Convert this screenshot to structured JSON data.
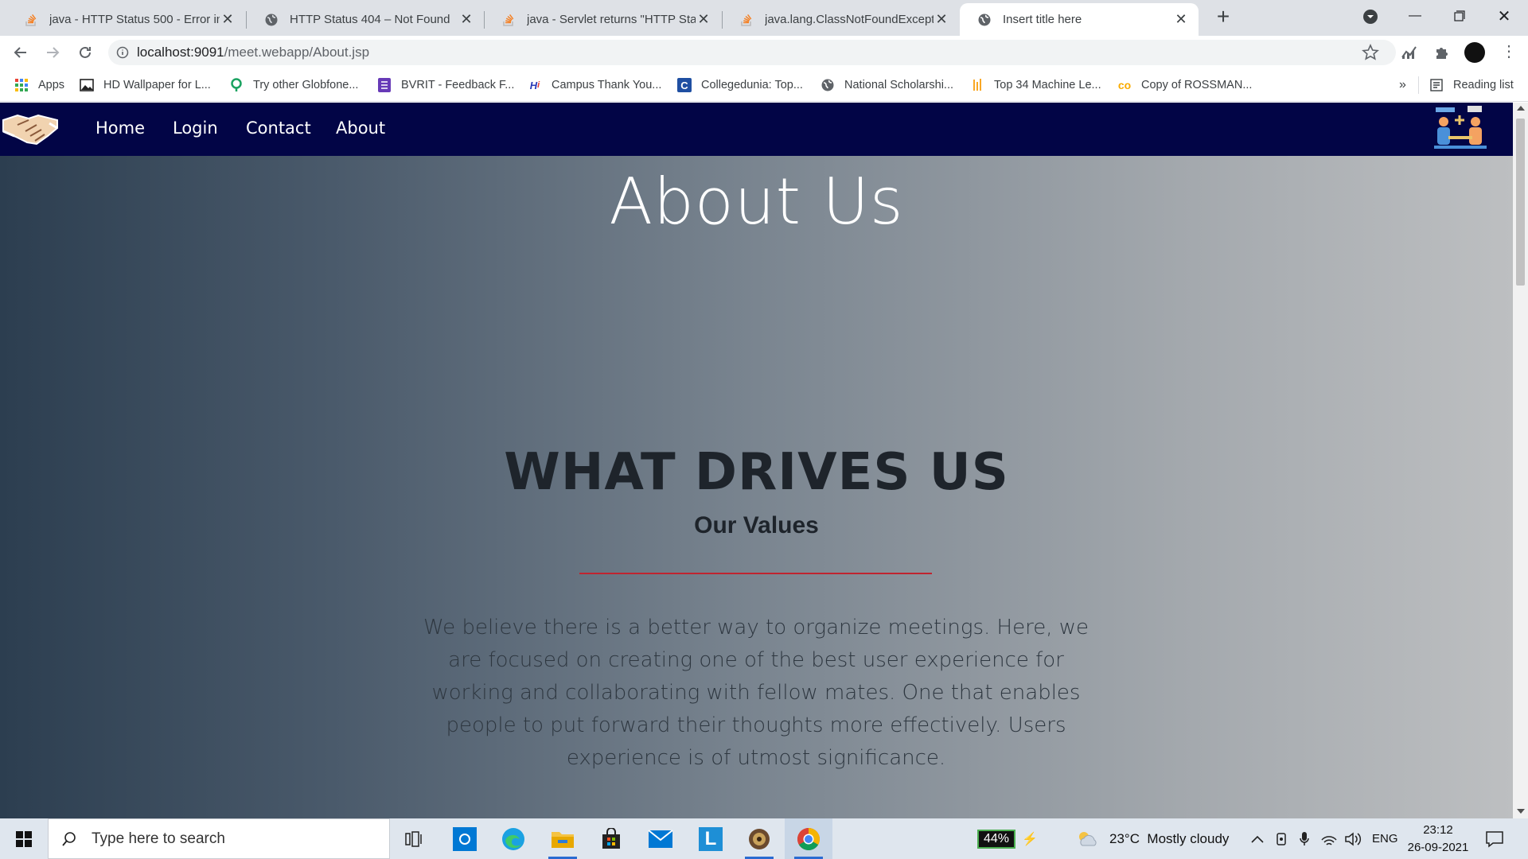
{
  "browser": {
    "tabs": [
      {
        "title": "java - HTTP Status 500 - Error ins",
        "icon": "stackoverflow-icon",
        "active": false
      },
      {
        "title": "HTTP Status 404 – Not Found",
        "icon": "globe-icon",
        "active": false
      },
      {
        "title": "java - Servlet returns \"HTTP Statu",
        "icon": "stackoverflow-icon",
        "active": false
      },
      {
        "title": "java.lang.ClassNotFoundExceptio",
        "icon": "stackoverflow-icon",
        "active": false
      },
      {
        "title": "Insert title here",
        "icon": "globe-icon",
        "active": true
      }
    ],
    "new_tab": "+",
    "url_host": "localhost:9091",
    "url_path": "/meet.webapp/About.jsp",
    "bookmarks": [
      {
        "label": "Apps",
        "icon": "apps-grid-icon"
      },
      {
        "label": "HD Wallpaper for L...",
        "icon": "image-icon"
      },
      {
        "label": "Try other Globfone...",
        "icon": "globfone-icon"
      },
      {
        "label": "BVRIT - Feedback F...",
        "icon": "form-icon"
      },
      {
        "label": "Campus Thank You...",
        "icon": "hi-logo-icon"
      },
      {
        "label": "Collegedunia: Top...",
        "icon": "collegedunia-icon"
      },
      {
        "label": "National Scholarshi...",
        "icon": "globe-icon"
      },
      {
        "label": "Top 34 Machine Le...",
        "icon": "ml-icon"
      },
      {
        "label": "Copy of ROSSMAN...",
        "icon": "colab-icon"
      }
    ],
    "bookmarks_more": "»",
    "reading_list": "Reading list"
  },
  "page": {
    "nav": {
      "home": "Home",
      "login": "Login",
      "contact": "Contact",
      "about": "About"
    },
    "title": "About Us",
    "heading": "WHAT DRIVES US",
    "subheading": "Our Values",
    "paragraph": "We believe there is a better way to organize meetings. Here, we are focused on creating one of the best user experience for working and collaborating with fellow mates. One that enables people to put forward their thoughts more effectively. Users experience is of utmost significance.",
    "colors": {
      "navbar": "#020546",
      "divider": "#c0242f",
      "heading": "#1e242b"
    }
  },
  "taskbar": {
    "search_placeholder": "Type here to search",
    "battery": "44%",
    "weather": "23°C  Mostly cloudy",
    "lang": "ENG",
    "time": "23:12",
    "date": "26-09-2021"
  }
}
